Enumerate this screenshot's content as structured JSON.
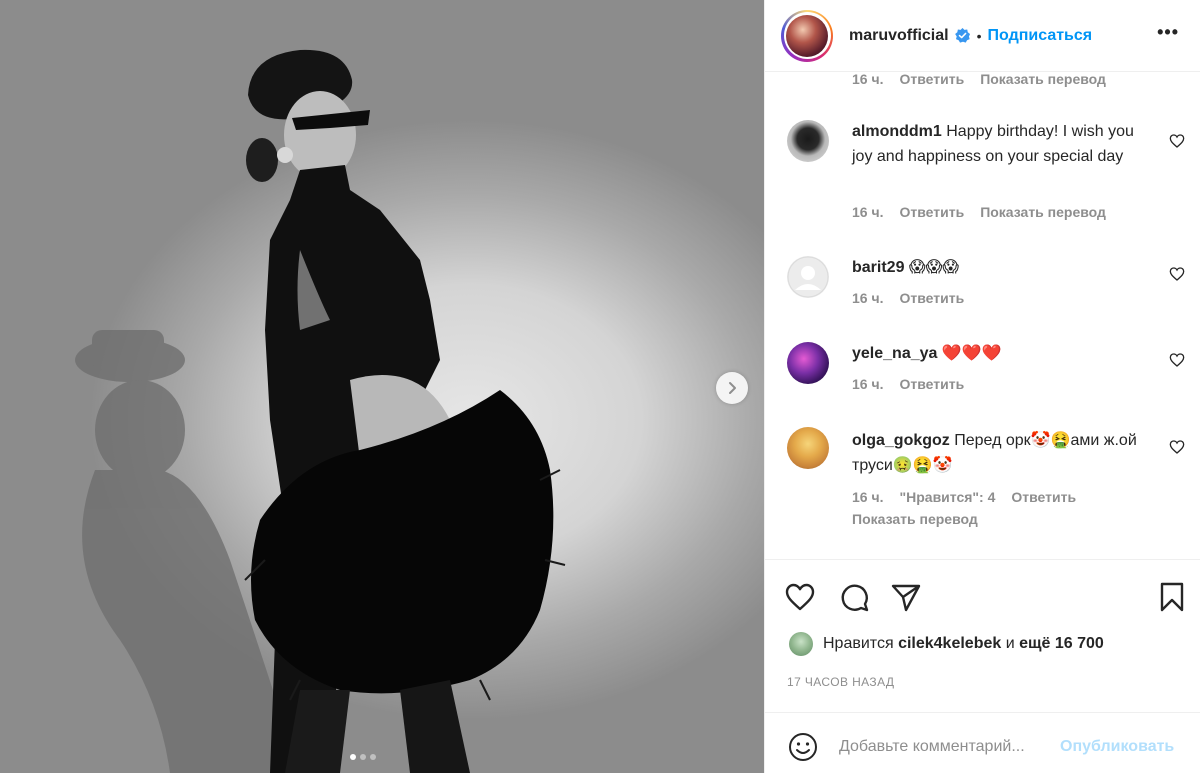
{
  "post": {
    "username": "maruvofficial",
    "separator": "•",
    "follow_label": "Подписаться",
    "more_label": "•••",
    "carousel": {
      "slides": 3,
      "active_index": 0
    }
  },
  "comments_panel": {
    "cut_meta": {
      "time": "16 ч.",
      "reply": "Ответить",
      "translate": "Показать перевод"
    },
    "items": [
      {
        "username": "almonddm1",
        "text": "Happy birthday! I wish you joy and happiness on your special day",
        "time": "16 ч.",
        "reply": "Ответить",
        "translate": "Показать перевод"
      },
      {
        "username": "barit29",
        "text": "😱😱😱",
        "time": "16 ч.",
        "reply": "Ответить"
      },
      {
        "username": "yele_na_ya",
        "text": "❤️❤️❤️",
        "time": "16 ч.",
        "reply": "Ответить"
      },
      {
        "username": "olga_gokgoz",
        "text": "Перед орк🤡🤮ами ж.ой труси🤢🤮🤡",
        "time": "16 ч.",
        "likes": "\"Нравится\": 4",
        "reply": "Ответить",
        "translate": "Показать перевод"
      }
    ]
  },
  "likes": {
    "prefix": "Нравится",
    "user": "cilek4kelebek",
    "middle": "и",
    "count": "ещё 16 700"
  },
  "timestamp": "17 ЧАСОВ НАЗАД",
  "comment_box": {
    "placeholder": "Добавьте комментарий...",
    "publish_label": "Опубликовать"
  },
  "colors": {
    "accent": "#0095f6",
    "publish_disabled": "#b2dffc",
    "meta_gray": "#8e8e8e",
    "text": "#262626"
  }
}
